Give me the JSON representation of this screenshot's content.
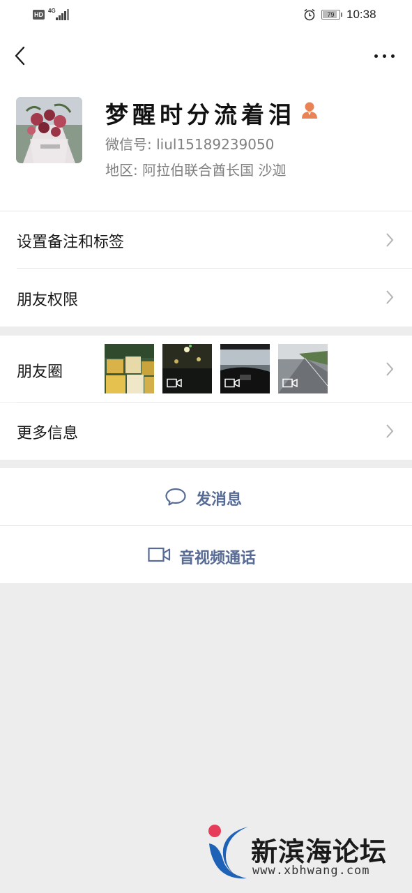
{
  "status_bar": {
    "hd_badge": "HD",
    "network": "4G",
    "battery": "79",
    "time": "10:38"
  },
  "profile": {
    "nickname": "梦醒时分流着泪",
    "wechat_id": "微信号: liul15189239050",
    "region": "地区: 阿拉伯联合酋长国  沙迦"
  },
  "menu": {
    "remark_tags": "设置备注和标签",
    "friend_permissions": "朋友权限",
    "moments": "朋友圈",
    "more_info": "更多信息"
  },
  "actions": {
    "send_message": "发消息",
    "av_call": "音视频通话"
  },
  "watermark": {
    "title": "新滨海论坛",
    "url": "www.xbhwang.com"
  },
  "colors": {
    "link_blue": "#576b95",
    "background_gray": "#ededed",
    "gender_icon": "#e98356"
  }
}
